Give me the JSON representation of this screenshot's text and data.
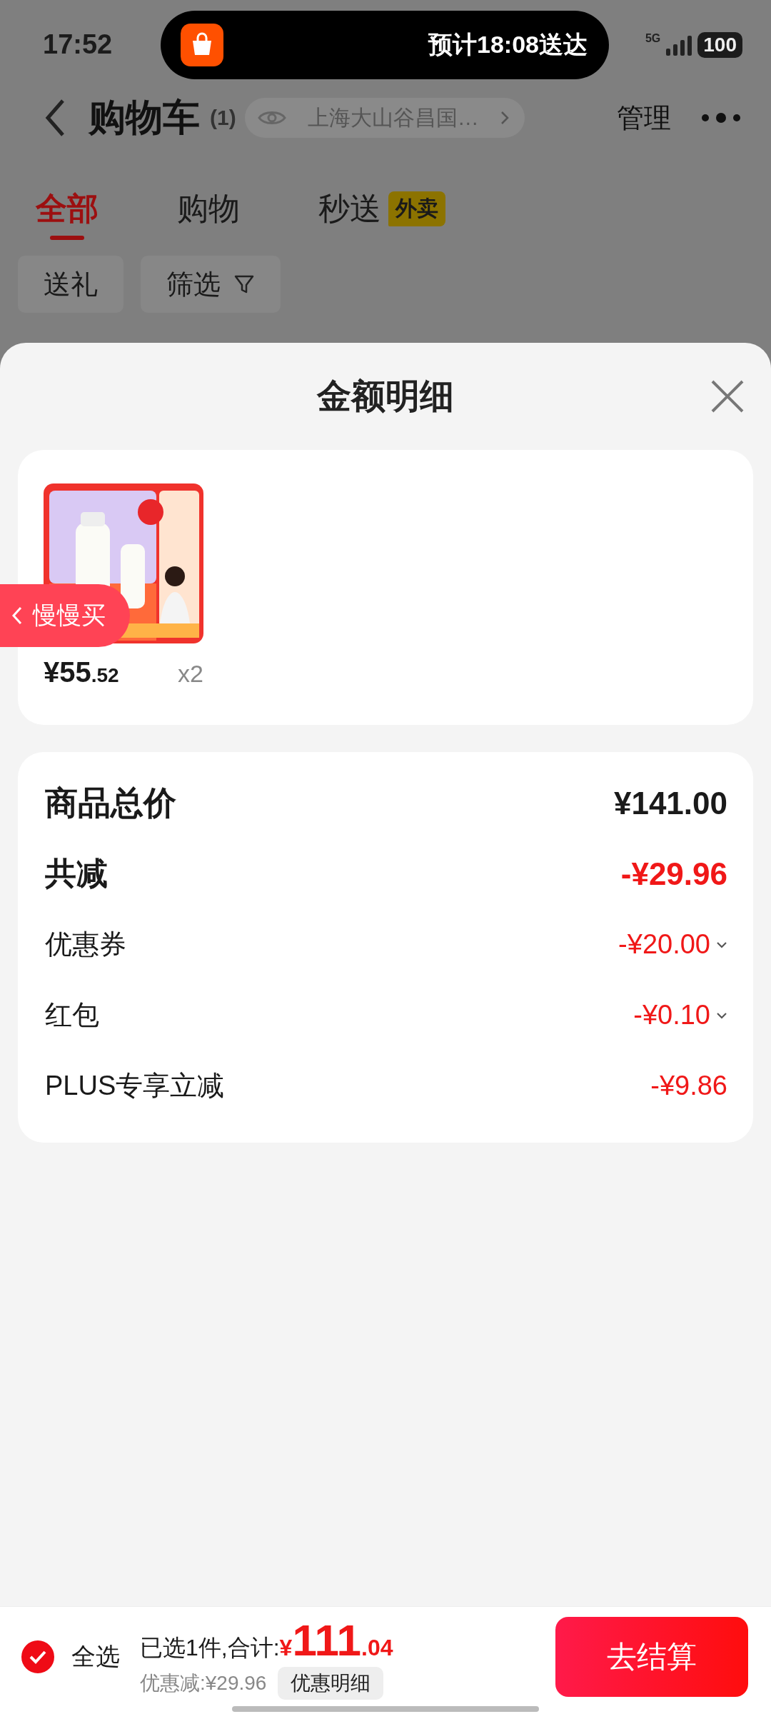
{
  "status_bar": {
    "time": "17:52",
    "live_activity": "预计18:08送达",
    "network": "5G",
    "battery": "100"
  },
  "header": {
    "title": "购物车",
    "count": "(1)",
    "address": "上海大山谷昌国…",
    "manage": "管理"
  },
  "tabs": [
    {
      "label": "全部",
      "selected": true
    },
    {
      "label": "购物",
      "selected": false
    },
    {
      "label": "秒送",
      "badge": "外卖",
      "selected": false
    }
  ],
  "chips": [
    {
      "label": "送礼",
      "kind": "plain"
    },
    {
      "label": "筛选",
      "kind": "filter"
    }
  ],
  "sheet": {
    "title": "金额明细"
  },
  "product": {
    "kind": "picture",
    "price": "¥55",
    "price_decimal": ".52",
    "quantity": "x2"
  },
  "float_tab": {
    "label": "慢慢买"
  },
  "summary": [
    {
      "label": "商品总价",
      "value": "¥141.00",
      "kind": "total",
      "expandable": false
    },
    {
      "label": "共减",
      "value": "-¥29.96",
      "kind": "discount_total",
      "expandable": false
    },
    {
      "label": "优惠券",
      "value": "-¥20.00",
      "kind": "discount",
      "expandable": true
    },
    {
      "label": "红包",
      "value": "-¥0.10",
      "kind": "discount",
      "expandable": true
    },
    {
      "label": "PLUS专享立减",
      "value": "-¥9.86",
      "kind": "discount",
      "expandable": false
    }
  ],
  "footer": {
    "select_all": {
      "label": "全选",
      "checked": true
    },
    "summary": "已选1件,合计:",
    "currency": "¥",
    "amount": "111",
    "amount_decimal": ".04",
    "saving": "优惠减:¥29.96",
    "detail_button": "优惠明细",
    "checkout": "去结算"
  }
}
